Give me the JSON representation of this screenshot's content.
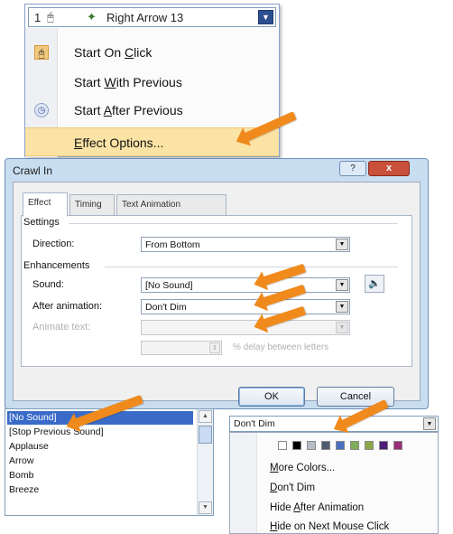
{
  "top_menu": {
    "order_number": "1",
    "effect_name": "Right Arrow 13",
    "items": [
      {
        "label": "Start On Click",
        "accel": "C"
      },
      {
        "label": "Start With Previous",
        "accel": "W"
      },
      {
        "label": "Start After Previous",
        "accel": "A"
      },
      {
        "label": "Effect Options...",
        "accel": "E"
      }
    ]
  },
  "dialog": {
    "title": "Crawl In",
    "help_label": "?",
    "close_label": "x",
    "tabs": [
      "Effect",
      "Timing",
      "Text Animation"
    ],
    "settings_heading": "Settings",
    "direction_label": "Direction:",
    "direction_value": "From Bottom",
    "enhancements_heading": "Enhancements",
    "sound_label": "Sound:",
    "sound_value": "[No Sound]",
    "after_animation_label": "After animation:",
    "after_animation_value": "Don't Dim",
    "animate_text_label": "Animate text:",
    "animate_text_value": "",
    "delay_label": "% delay between letters",
    "ok_label": "OK",
    "cancel_label": "Cancel"
  },
  "sound_list": [
    "[No Sound]",
    "[Stop Previous Sound]",
    "Applause",
    "Arrow",
    "Bomb",
    "Breeze"
  ],
  "dim_menu": {
    "combo_value": "Don't Dim",
    "swatch_colors": [
      "#ffffff",
      "#000000",
      "#b7bcc8",
      "#4e5a6e",
      "#4a6fbf",
      "#7fae5a",
      "#8aa84a",
      "#4b1f7a",
      "#9a2c7a"
    ],
    "items": [
      "More Colors...",
      "Don't Dim",
      "Hide After Animation",
      "Hide on Next Mouse Click"
    ]
  },
  "colors": {
    "arrow": "#f08a1c",
    "selection": "#3b6bc8",
    "menu_highlight": "#fbe3a6",
    "close_button": "#c9503b"
  }
}
